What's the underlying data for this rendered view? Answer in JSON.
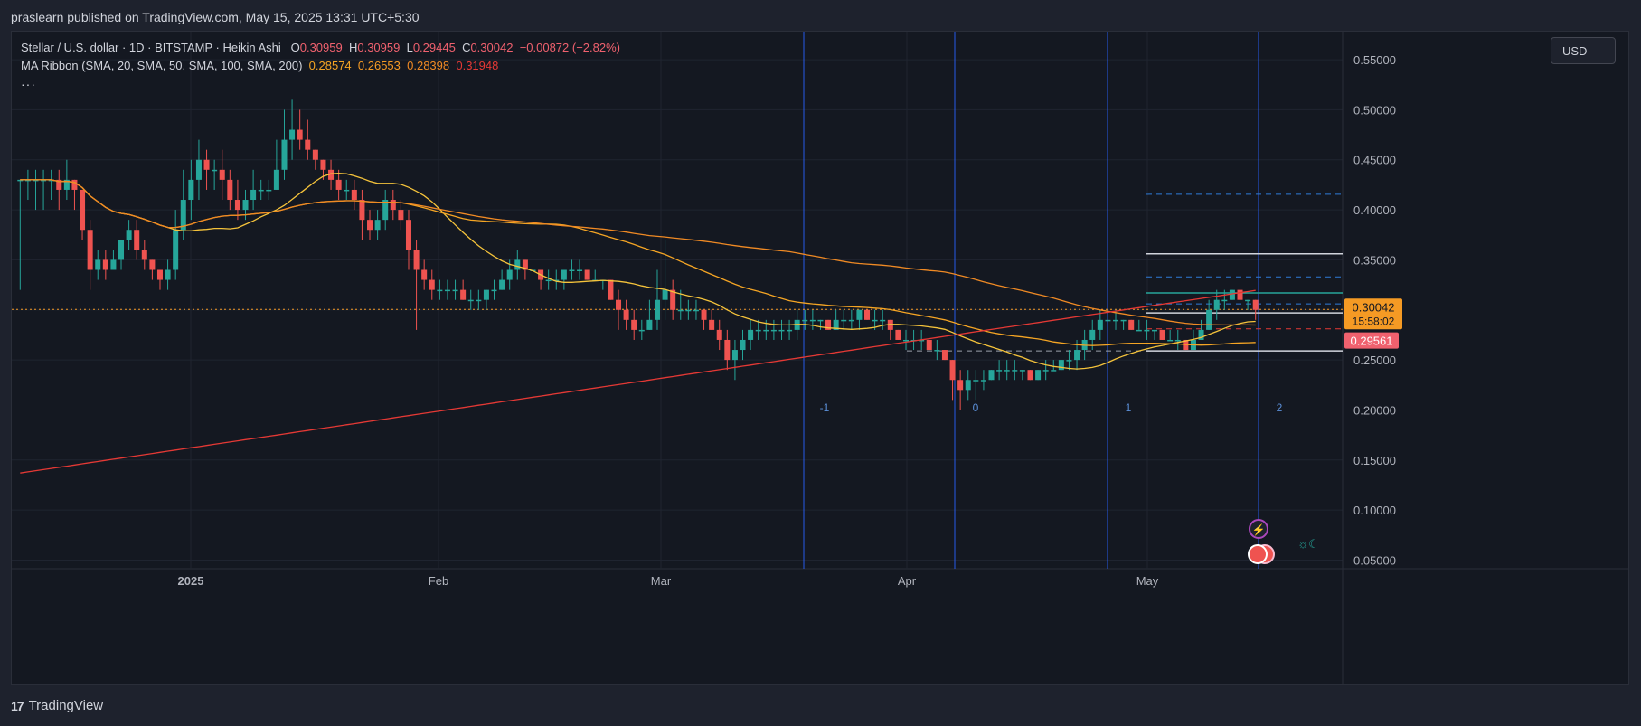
{
  "header": {
    "published": "praslearn published on TradingView.com, May 15, 2025 13:31 UTC+5:30"
  },
  "legend": {
    "symbol": "Stellar / U.S. dollar · 1D · BITSTAMP · Heikin Ashi",
    "o_label": "O",
    "o": "0.30959",
    "h_label": "H",
    "h": "0.30959",
    "l_label": "L",
    "l": "0.29445",
    "c_label": "C",
    "c": "0.30042",
    "change": "−0.00872 (−2.82%)",
    "ma_label": "MA Ribbon (SMA, 20, SMA, 50, SMA, 100, SMA, 200)",
    "ma1": "0.28574",
    "ma2": "0.26553",
    "ma3": "0.28398",
    "ma4": "0.31948",
    "more": "···"
  },
  "currency_button": "USD",
  "footer": {
    "logo_text": "TradingView"
  },
  "price_tags": {
    "current": "0.30042",
    "countdown": "15:58:02",
    "red": "0.29561"
  },
  "colors": {
    "bg": "#141821",
    "up": "#26a69a",
    "down": "#ef5350",
    "ma20": "#f5c33b",
    "ma50": "#f5a524",
    "ma100": "#f08a24",
    "ma200": "#e53935",
    "vline": "#2962ff"
  },
  "icons": {
    "lightning": "lightning-icon",
    "flag": "us-flag-icon",
    "waves": "waves-icon"
  },
  "chart_data": {
    "type": "candlestick",
    "y_axis": {
      "ticks": [
        "0.05000",
        "0.10000",
        "0.15000",
        "0.20000",
        "0.25000",
        "0.30000",
        "0.35000",
        "0.40000",
        "0.45000",
        "0.50000",
        "0.55000"
      ],
      "range": [
        0.045,
        0.56
      ]
    },
    "x_axis": {
      "ticks": [
        "2025",
        "Feb",
        "Mar",
        "Apr",
        "May"
      ]
    },
    "fib_labels": [
      "-1",
      "0",
      "1",
      "2"
    ],
    "overlay_levels": [
      0.4155,
      0.356,
      0.333,
      0.317,
      0.306,
      0.297,
      0.281,
      0.259
    ],
    "candles": [
      {
        "o": 0.43,
        "h": 0.43,
        "l": 0.32,
        "c": 0.43
      },
      {
        "o": 0.43,
        "h": 0.44,
        "l": 0.41,
        "c": 0.43
      },
      {
        "o": 0.43,
        "h": 0.44,
        "l": 0.4,
        "c": 0.43
      },
      {
        "o": 0.43,
        "h": 0.44,
        "l": 0.4,
        "c": 0.43
      },
      {
        "o": 0.43,
        "h": 0.44,
        "l": 0.41,
        "c": 0.43
      },
      {
        "o": 0.43,
        "h": 0.44,
        "l": 0.4,
        "c": 0.42
      },
      {
        "o": 0.42,
        "h": 0.45,
        "l": 0.41,
        "c": 0.43
      },
      {
        "o": 0.43,
        "h": 0.43,
        "l": 0.4,
        "c": 0.42
      },
      {
        "o": 0.42,
        "h": 0.42,
        "l": 0.37,
        "c": 0.38
      },
      {
        "o": 0.38,
        "h": 0.39,
        "l": 0.32,
        "c": 0.34
      },
      {
        "o": 0.34,
        "h": 0.36,
        "l": 0.33,
        "c": 0.35
      },
      {
        "o": 0.35,
        "h": 0.36,
        "l": 0.33,
        "c": 0.34
      },
      {
        "o": 0.34,
        "h": 0.36,
        "l": 0.34,
        "c": 0.35
      },
      {
        "o": 0.35,
        "h": 0.37,
        "l": 0.34,
        "c": 0.37
      },
      {
        "o": 0.37,
        "h": 0.39,
        "l": 0.36,
        "c": 0.38
      },
      {
        "o": 0.38,
        "h": 0.39,
        "l": 0.35,
        "c": 0.36
      },
      {
        "o": 0.36,
        "h": 0.37,
        "l": 0.34,
        "c": 0.35
      },
      {
        "o": 0.35,
        "h": 0.35,
        "l": 0.33,
        "c": 0.34
      },
      {
        "o": 0.34,
        "h": 0.34,
        "l": 0.32,
        "c": 0.33
      },
      {
        "o": 0.33,
        "h": 0.35,
        "l": 0.32,
        "c": 0.34
      },
      {
        "o": 0.34,
        "h": 0.4,
        "l": 0.33,
        "c": 0.38
      },
      {
        "o": 0.38,
        "h": 0.44,
        "l": 0.37,
        "c": 0.41
      },
      {
        "o": 0.41,
        "h": 0.45,
        "l": 0.39,
        "c": 0.43
      },
      {
        "o": 0.43,
        "h": 0.47,
        "l": 0.41,
        "c": 0.45
      },
      {
        "o": 0.45,
        "h": 0.46,
        "l": 0.42,
        "c": 0.44
      },
      {
        "o": 0.44,
        "h": 0.45,
        "l": 0.42,
        "c": 0.44
      },
      {
        "o": 0.44,
        "h": 0.46,
        "l": 0.41,
        "c": 0.43
      },
      {
        "o": 0.43,
        "h": 0.44,
        "l": 0.4,
        "c": 0.41
      },
      {
        "o": 0.41,
        "h": 0.43,
        "l": 0.39,
        "c": 0.4
      },
      {
        "o": 0.4,
        "h": 0.42,
        "l": 0.39,
        "c": 0.41
      },
      {
        "o": 0.41,
        "h": 0.44,
        "l": 0.4,
        "c": 0.42
      },
      {
        "o": 0.42,
        "h": 0.43,
        "l": 0.41,
        "c": 0.42
      },
      {
        "o": 0.42,
        "h": 0.43,
        "l": 0.41,
        "c": 0.42
      },
      {
        "o": 0.42,
        "h": 0.47,
        "l": 0.42,
        "c": 0.44
      },
      {
        "o": 0.44,
        "h": 0.5,
        "l": 0.43,
        "c": 0.47
      },
      {
        "o": 0.47,
        "h": 0.51,
        "l": 0.45,
        "c": 0.48
      },
      {
        "o": 0.48,
        "h": 0.5,
        "l": 0.46,
        "c": 0.47
      },
      {
        "o": 0.47,
        "h": 0.49,
        "l": 0.45,
        "c": 0.46
      },
      {
        "o": 0.46,
        "h": 0.46,
        "l": 0.44,
        "c": 0.45
      },
      {
        "o": 0.45,
        "h": 0.45,
        "l": 0.43,
        "c": 0.44
      },
      {
        "o": 0.44,
        "h": 0.45,
        "l": 0.42,
        "c": 0.43
      },
      {
        "o": 0.43,
        "h": 0.44,
        "l": 0.41,
        "c": 0.42
      },
      {
        "o": 0.42,
        "h": 0.43,
        "l": 0.41,
        "c": 0.42
      },
      {
        "o": 0.42,
        "h": 0.43,
        "l": 0.4,
        "c": 0.41
      },
      {
        "o": 0.41,
        "h": 0.42,
        "l": 0.37,
        "c": 0.39
      },
      {
        "o": 0.39,
        "h": 0.4,
        "l": 0.37,
        "c": 0.38
      },
      {
        "o": 0.38,
        "h": 0.4,
        "l": 0.37,
        "c": 0.39
      },
      {
        "o": 0.39,
        "h": 0.42,
        "l": 0.38,
        "c": 0.41
      },
      {
        "o": 0.41,
        "h": 0.42,
        "l": 0.39,
        "c": 0.4
      },
      {
        "o": 0.4,
        "h": 0.41,
        "l": 0.38,
        "c": 0.39
      },
      {
        "o": 0.39,
        "h": 0.4,
        "l": 0.34,
        "c": 0.36
      },
      {
        "o": 0.36,
        "h": 0.37,
        "l": 0.28,
        "c": 0.34
      },
      {
        "o": 0.34,
        "h": 0.35,
        "l": 0.32,
        "c": 0.33
      },
      {
        "o": 0.33,
        "h": 0.34,
        "l": 0.31,
        "c": 0.32
      },
      {
        "o": 0.32,
        "h": 0.33,
        "l": 0.31,
        "c": 0.32
      },
      {
        "o": 0.32,
        "h": 0.33,
        "l": 0.31,
        "c": 0.32
      },
      {
        "o": 0.32,
        "h": 0.33,
        "l": 0.31,
        "c": 0.32
      },
      {
        "o": 0.32,
        "h": 0.33,
        "l": 0.31,
        "c": 0.31
      },
      {
        "o": 0.31,
        "h": 0.32,
        "l": 0.3,
        "c": 0.31
      },
      {
        "o": 0.31,
        "h": 0.32,
        "l": 0.3,
        "c": 0.31
      },
      {
        "o": 0.31,
        "h": 0.32,
        "l": 0.3,
        "c": 0.32
      },
      {
        "o": 0.32,
        "h": 0.33,
        "l": 0.31,
        "c": 0.32
      },
      {
        "o": 0.32,
        "h": 0.34,
        "l": 0.32,
        "c": 0.33
      },
      {
        "o": 0.33,
        "h": 0.35,
        "l": 0.32,
        "c": 0.34
      },
      {
        "o": 0.34,
        "h": 0.36,
        "l": 0.33,
        "c": 0.35
      },
      {
        "o": 0.35,
        "h": 0.35,
        "l": 0.33,
        "c": 0.34
      },
      {
        "o": 0.34,
        "h": 0.35,
        "l": 0.33,
        "c": 0.34
      },
      {
        "o": 0.34,
        "h": 0.34,
        "l": 0.32,
        "c": 0.33
      },
      {
        "o": 0.33,
        "h": 0.34,
        "l": 0.32,
        "c": 0.33
      },
      {
        "o": 0.33,
        "h": 0.34,
        "l": 0.32,
        "c": 0.33
      },
      {
        "o": 0.33,
        "h": 0.34,
        "l": 0.32,
        "c": 0.34
      },
      {
        "o": 0.34,
        "h": 0.35,
        "l": 0.33,
        "c": 0.34
      },
      {
        "o": 0.34,
        "h": 0.35,
        "l": 0.33,
        "c": 0.34
      },
      {
        "o": 0.34,
        "h": 0.34,
        "l": 0.33,
        "c": 0.33
      },
      {
        "o": 0.33,
        "h": 0.34,
        "l": 0.33,
        "c": 0.33
      },
      {
        "o": 0.33,
        "h": 0.33,
        "l": 0.32,
        "c": 0.33
      },
      {
        "o": 0.33,
        "h": 0.33,
        "l": 0.31,
        "c": 0.31
      },
      {
        "o": 0.31,
        "h": 0.32,
        "l": 0.28,
        "c": 0.3
      },
      {
        "o": 0.3,
        "h": 0.31,
        "l": 0.28,
        "c": 0.29
      },
      {
        "o": 0.29,
        "h": 0.3,
        "l": 0.27,
        "c": 0.28
      },
      {
        "o": 0.28,
        "h": 0.29,
        "l": 0.27,
        "c": 0.28
      },
      {
        "o": 0.28,
        "h": 0.31,
        "l": 0.28,
        "c": 0.29
      },
      {
        "o": 0.29,
        "h": 0.34,
        "l": 0.28,
        "c": 0.31
      },
      {
        "o": 0.31,
        "h": 0.37,
        "l": 0.29,
        "c": 0.32
      },
      {
        "o": 0.32,
        "h": 0.33,
        "l": 0.29,
        "c": 0.3
      },
      {
        "o": 0.3,
        "h": 0.32,
        "l": 0.29,
        "c": 0.3
      },
      {
        "o": 0.3,
        "h": 0.31,
        "l": 0.29,
        "c": 0.3
      },
      {
        "o": 0.3,
        "h": 0.31,
        "l": 0.29,
        "c": 0.3
      },
      {
        "o": 0.3,
        "h": 0.3,
        "l": 0.28,
        "c": 0.29
      },
      {
        "o": 0.29,
        "h": 0.3,
        "l": 0.28,
        "c": 0.28
      },
      {
        "o": 0.28,
        "h": 0.29,
        "l": 0.26,
        "c": 0.27
      },
      {
        "o": 0.27,
        "h": 0.28,
        "l": 0.24,
        "c": 0.25
      },
      {
        "o": 0.25,
        "h": 0.27,
        "l": 0.23,
        "c": 0.26
      },
      {
        "o": 0.26,
        "h": 0.28,
        "l": 0.25,
        "c": 0.27
      },
      {
        "o": 0.27,
        "h": 0.29,
        "l": 0.26,
        "c": 0.28
      },
      {
        "o": 0.28,
        "h": 0.29,
        "l": 0.27,
        "c": 0.28
      },
      {
        "o": 0.28,
        "h": 0.29,
        "l": 0.27,
        "c": 0.28
      },
      {
        "o": 0.28,
        "h": 0.29,
        "l": 0.27,
        "c": 0.28
      },
      {
        "o": 0.28,
        "h": 0.29,
        "l": 0.27,
        "c": 0.28
      },
      {
        "o": 0.28,
        "h": 0.29,
        "l": 0.27,
        "c": 0.28
      },
      {
        "o": 0.28,
        "h": 0.3,
        "l": 0.27,
        "c": 0.29
      },
      {
        "o": 0.29,
        "h": 0.3,
        "l": 0.28,
        "c": 0.29
      },
      {
        "o": 0.29,
        "h": 0.3,
        "l": 0.28,
        "c": 0.29
      },
      {
        "o": 0.29,
        "h": 0.29,
        "l": 0.28,
        "c": 0.29
      },
      {
        "o": 0.29,
        "h": 0.29,
        "l": 0.28,
        "c": 0.28
      },
      {
        "o": 0.28,
        "h": 0.3,
        "l": 0.28,
        "c": 0.29
      },
      {
        "o": 0.29,
        "h": 0.3,
        "l": 0.28,
        "c": 0.29
      },
      {
        "o": 0.29,
        "h": 0.3,
        "l": 0.28,
        "c": 0.29
      },
      {
        "o": 0.29,
        "h": 0.3,
        "l": 0.28,
        "c": 0.3
      },
      {
        "o": 0.3,
        "h": 0.3,
        "l": 0.29,
        "c": 0.29
      },
      {
        "o": 0.29,
        "h": 0.3,
        "l": 0.28,
        "c": 0.29
      },
      {
        "o": 0.29,
        "h": 0.3,
        "l": 0.28,
        "c": 0.29
      },
      {
        "o": 0.29,
        "h": 0.29,
        "l": 0.27,
        "c": 0.28
      },
      {
        "o": 0.28,
        "h": 0.28,
        "l": 0.27,
        "c": 0.27
      },
      {
        "o": 0.27,
        "h": 0.28,
        "l": 0.26,
        "c": 0.27
      },
      {
        "o": 0.27,
        "h": 0.28,
        "l": 0.26,
        "c": 0.27
      },
      {
        "o": 0.27,
        "h": 0.28,
        "l": 0.26,
        "c": 0.27
      },
      {
        "o": 0.27,
        "h": 0.27,
        "l": 0.26,
        "c": 0.26
      },
      {
        "o": 0.26,
        "h": 0.27,
        "l": 0.25,
        "c": 0.26
      },
      {
        "o": 0.26,
        "h": 0.26,
        "l": 0.25,
        "c": 0.25
      },
      {
        "o": 0.25,
        "h": 0.25,
        "l": 0.21,
        "c": 0.23
      },
      {
        "o": 0.23,
        "h": 0.24,
        "l": 0.2,
        "c": 0.22
      },
      {
        "o": 0.22,
        "h": 0.24,
        "l": 0.21,
        "c": 0.23
      },
      {
        "o": 0.23,
        "h": 0.24,
        "l": 0.21,
        "c": 0.23
      },
      {
        "o": 0.23,
        "h": 0.24,
        "l": 0.22,
        "c": 0.23
      },
      {
        "o": 0.23,
        "h": 0.24,
        "l": 0.23,
        "c": 0.24
      },
      {
        "o": 0.24,
        "h": 0.25,
        "l": 0.23,
        "c": 0.24
      },
      {
        "o": 0.24,
        "h": 0.25,
        "l": 0.23,
        "c": 0.24
      },
      {
        "o": 0.24,
        "h": 0.25,
        "l": 0.23,
        "c": 0.24
      },
      {
        "o": 0.24,
        "h": 0.24,
        "l": 0.23,
        "c": 0.24
      },
      {
        "o": 0.24,
        "h": 0.24,
        "l": 0.23,
        "c": 0.23
      },
      {
        "o": 0.23,
        "h": 0.24,
        "l": 0.23,
        "c": 0.24
      },
      {
        "o": 0.24,
        "h": 0.25,
        "l": 0.23,
        "c": 0.24
      },
      {
        "o": 0.24,
        "h": 0.25,
        "l": 0.24,
        "c": 0.24
      },
      {
        "o": 0.24,
        "h": 0.25,
        "l": 0.24,
        "c": 0.25
      },
      {
        "o": 0.25,
        "h": 0.26,
        "l": 0.24,
        "c": 0.25
      },
      {
        "o": 0.25,
        "h": 0.27,
        "l": 0.24,
        "c": 0.26
      },
      {
        "o": 0.26,
        "h": 0.28,
        "l": 0.25,
        "c": 0.27
      },
      {
        "o": 0.27,
        "h": 0.29,
        "l": 0.26,
        "c": 0.28
      },
      {
        "o": 0.28,
        "h": 0.3,
        "l": 0.27,
        "c": 0.29
      },
      {
        "o": 0.29,
        "h": 0.3,
        "l": 0.28,
        "c": 0.29
      },
      {
        "o": 0.29,
        "h": 0.3,
        "l": 0.28,
        "c": 0.29
      },
      {
        "o": 0.29,
        "h": 0.29,
        "l": 0.28,
        "c": 0.29
      },
      {
        "o": 0.29,
        "h": 0.29,
        "l": 0.28,
        "c": 0.28
      },
      {
        "o": 0.28,
        "h": 0.29,
        "l": 0.28,
        "c": 0.28
      },
      {
        "o": 0.28,
        "h": 0.29,
        "l": 0.27,
        "c": 0.28
      },
      {
        "o": 0.28,
        "h": 0.28,
        "l": 0.27,
        "c": 0.28
      },
      {
        "o": 0.28,
        "h": 0.28,
        "l": 0.27,
        "c": 0.27
      },
      {
        "o": 0.27,
        "h": 0.28,
        "l": 0.27,
        "c": 0.27
      },
      {
        "o": 0.27,
        "h": 0.28,
        "l": 0.26,
        "c": 0.27
      },
      {
        "o": 0.27,
        "h": 0.27,
        "l": 0.26,
        "c": 0.26
      },
      {
        "o": 0.26,
        "h": 0.28,
        "l": 0.26,
        "c": 0.27
      },
      {
        "o": 0.27,
        "h": 0.29,
        "l": 0.27,
        "c": 0.28
      },
      {
        "o": 0.28,
        "h": 0.31,
        "l": 0.28,
        "c": 0.3
      },
      {
        "o": 0.3,
        "h": 0.32,
        "l": 0.29,
        "c": 0.31
      },
      {
        "o": 0.31,
        "h": 0.32,
        "l": 0.3,
        "c": 0.31
      },
      {
        "o": 0.31,
        "h": 0.32,
        "l": 0.31,
        "c": 0.32
      },
      {
        "o": 0.32,
        "h": 0.33,
        "l": 0.31,
        "c": 0.31
      },
      {
        "o": 0.31,
        "h": 0.31,
        "l": 0.3,
        "c": 0.31
      },
      {
        "o": 0.31,
        "h": 0.31,
        "l": 0.29,
        "c": 0.3
      }
    ]
  }
}
